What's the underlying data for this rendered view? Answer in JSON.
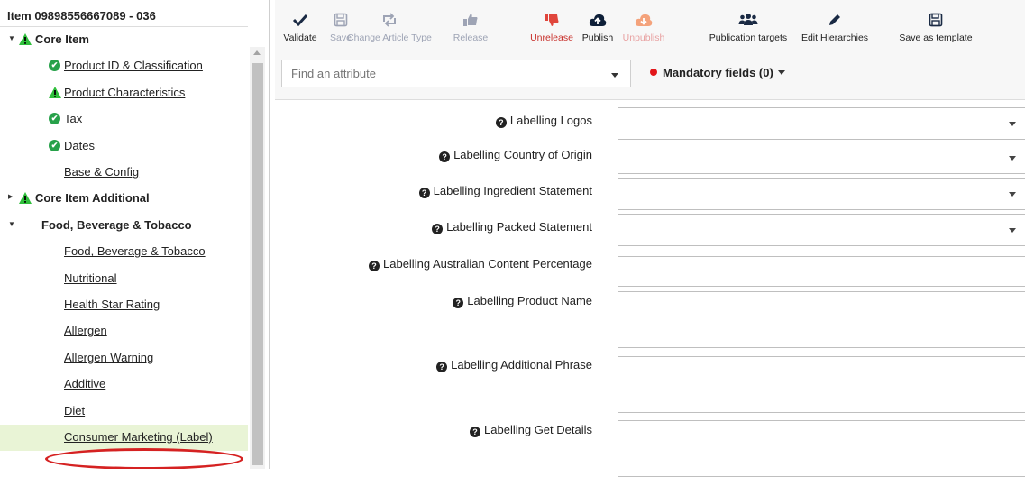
{
  "item": {
    "title": "Item 09898556667089 - 036"
  },
  "tree": [
    {
      "label": "Core Item",
      "kind": "group",
      "status": "warn",
      "caret": "down"
    },
    {
      "label": "Product ID & Classification",
      "kind": "link",
      "status": "check"
    },
    {
      "label": "Product Characteristics",
      "kind": "link",
      "status": "warn"
    },
    {
      "label": "Tax",
      "kind": "link",
      "status": "check"
    },
    {
      "label": "Dates",
      "kind": "link",
      "status": "check"
    },
    {
      "label": "Base & Config",
      "kind": "link",
      "status": "none"
    },
    {
      "label": "Core Item Additional",
      "kind": "group",
      "status": "warn",
      "caret": "right"
    },
    {
      "label": "Food, Beverage & Tobacco",
      "kind": "group",
      "status": "none",
      "caret": "down"
    },
    {
      "label": "Food, Beverage & Tobacco",
      "kind": "link",
      "status": "none"
    },
    {
      "label": "Nutritional",
      "kind": "link",
      "status": "none"
    },
    {
      "label": "Health Star Rating",
      "kind": "link",
      "status": "none"
    },
    {
      "label": "Allergen",
      "kind": "link",
      "status": "none"
    },
    {
      "label": "Allergen Warning",
      "kind": "link",
      "status": "none"
    },
    {
      "label": "Additive",
      "kind": "link",
      "status": "none"
    },
    {
      "label": "Diet",
      "kind": "link",
      "status": "none"
    },
    {
      "label": "Consumer Marketing (Label)",
      "kind": "link",
      "status": "none",
      "selected": true
    }
  ],
  "toolbar": [
    {
      "label": "Validate",
      "icon": "checkmark-icon",
      "state": "normal"
    },
    {
      "label": "Save",
      "icon": "floppy-disk-icon",
      "state": "disabled"
    },
    {
      "label": "Change Article Type",
      "icon": "retweet-icon",
      "state": "disabled"
    },
    {
      "label": "Release",
      "icon": "thumbs-up-icon",
      "state": "disabled"
    },
    {
      "label": "Unrelease",
      "icon": "thumbs-down-icon",
      "state": "red"
    },
    {
      "label": "Publish",
      "icon": "cloud-upload-icon",
      "state": "normal"
    },
    {
      "label": "Unpublish",
      "icon": "cloud-download-icon",
      "state": "pink"
    },
    {
      "label": "Publication targets",
      "icon": "users-icon",
      "state": "normal"
    },
    {
      "label": "Edit Hierarchies",
      "icon": "pencil-icon",
      "state": "normal"
    },
    {
      "label": "Save as template",
      "icon": "floppy-disk-icon",
      "state": "normal"
    }
  ],
  "search": {
    "placeholder": "Find an attribute"
  },
  "mandatory": {
    "label": "Mandatory fields (0)"
  },
  "fields": [
    {
      "label": "Labelling Logos",
      "type": "select"
    },
    {
      "label": "Labelling Country of Origin",
      "type": "select"
    },
    {
      "label": "Labelling Ingredient Statement",
      "type": "select"
    },
    {
      "label": "Labelling Packed Statement",
      "type": "select"
    },
    {
      "label": "Labelling Australian Content Percentage",
      "type": "text"
    },
    {
      "label": "Labelling Product Name",
      "type": "textarea"
    },
    {
      "label": "Labelling Additional Phrase",
      "type": "textarea"
    },
    {
      "label": "Labelling Get Details",
      "type": "textarea"
    }
  ],
  "colors": {
    "check": "#27a14a",
    "warn": "#2fbf3b",
    "red": "#c8302b",
    "highlight": "#e9f4d6",
    "annotation": "#d52222"
  }
}
